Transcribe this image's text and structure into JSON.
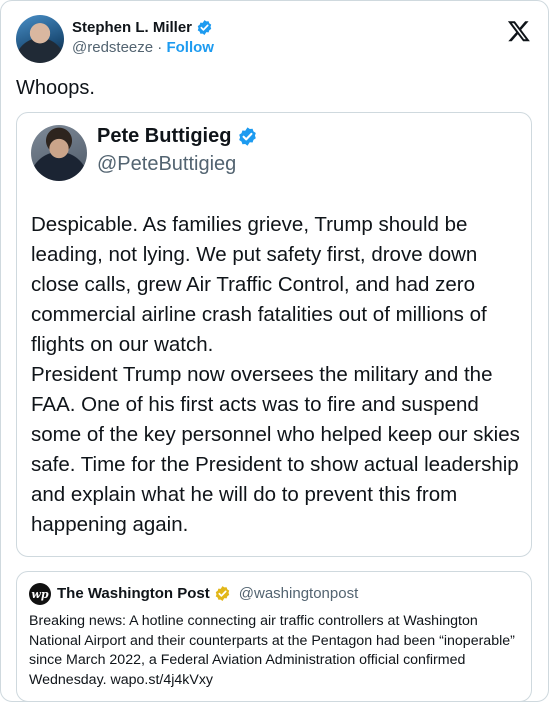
{
  "post": {
    "author": {
      "name": "Stephen L. Miller",
      "handle": "@redsteeze",
      "separator": "·",
      "follow_label": "Follow"
    },
    "text": "Whoops.",
    "brand_icon": "x-logo-icon"
  },
  "quoted_post": {
    "author": {
      "name": "Pete Buttigieg",
      "handle": "@PeteButtigieg"
    },
    "text": "Despicable. As families grieve, Trump should be leading, not lying. We put safety first, drove down close calls, grew Air Traffic Control, and had zero commercial airline crash fatalities out of millions of flights on our watch.\nPresident Trump now oversees the military and the FAA. One of his first acts was to fire and suspend some of the key personnel who helped keep our skies safe. Time for the President to show actual leadership and explain what he will do to prevent this from happening again."
  },
  "nested_quote": {
    "logo_text": "wp",
    "author": {
      "name": "The Washington Post",
      "handle": "@washingtonpost"
    },
    "text": "Breaking news: A hotline connecting air traffic controllers at Washington National Airport and their counterparts at the Pentagon had been “inoperable” since March 2022, a Federal Aviation Administration official confirmed Wednesday. wapo.st/4j4kVxy"
  },
  "colors": {
    "verified_blue": "#1d9bf0",
    "verified_gold": "#e2b719",
    "secondary_text": "#536471",
    "border": "#cfd9de"
  }
}
